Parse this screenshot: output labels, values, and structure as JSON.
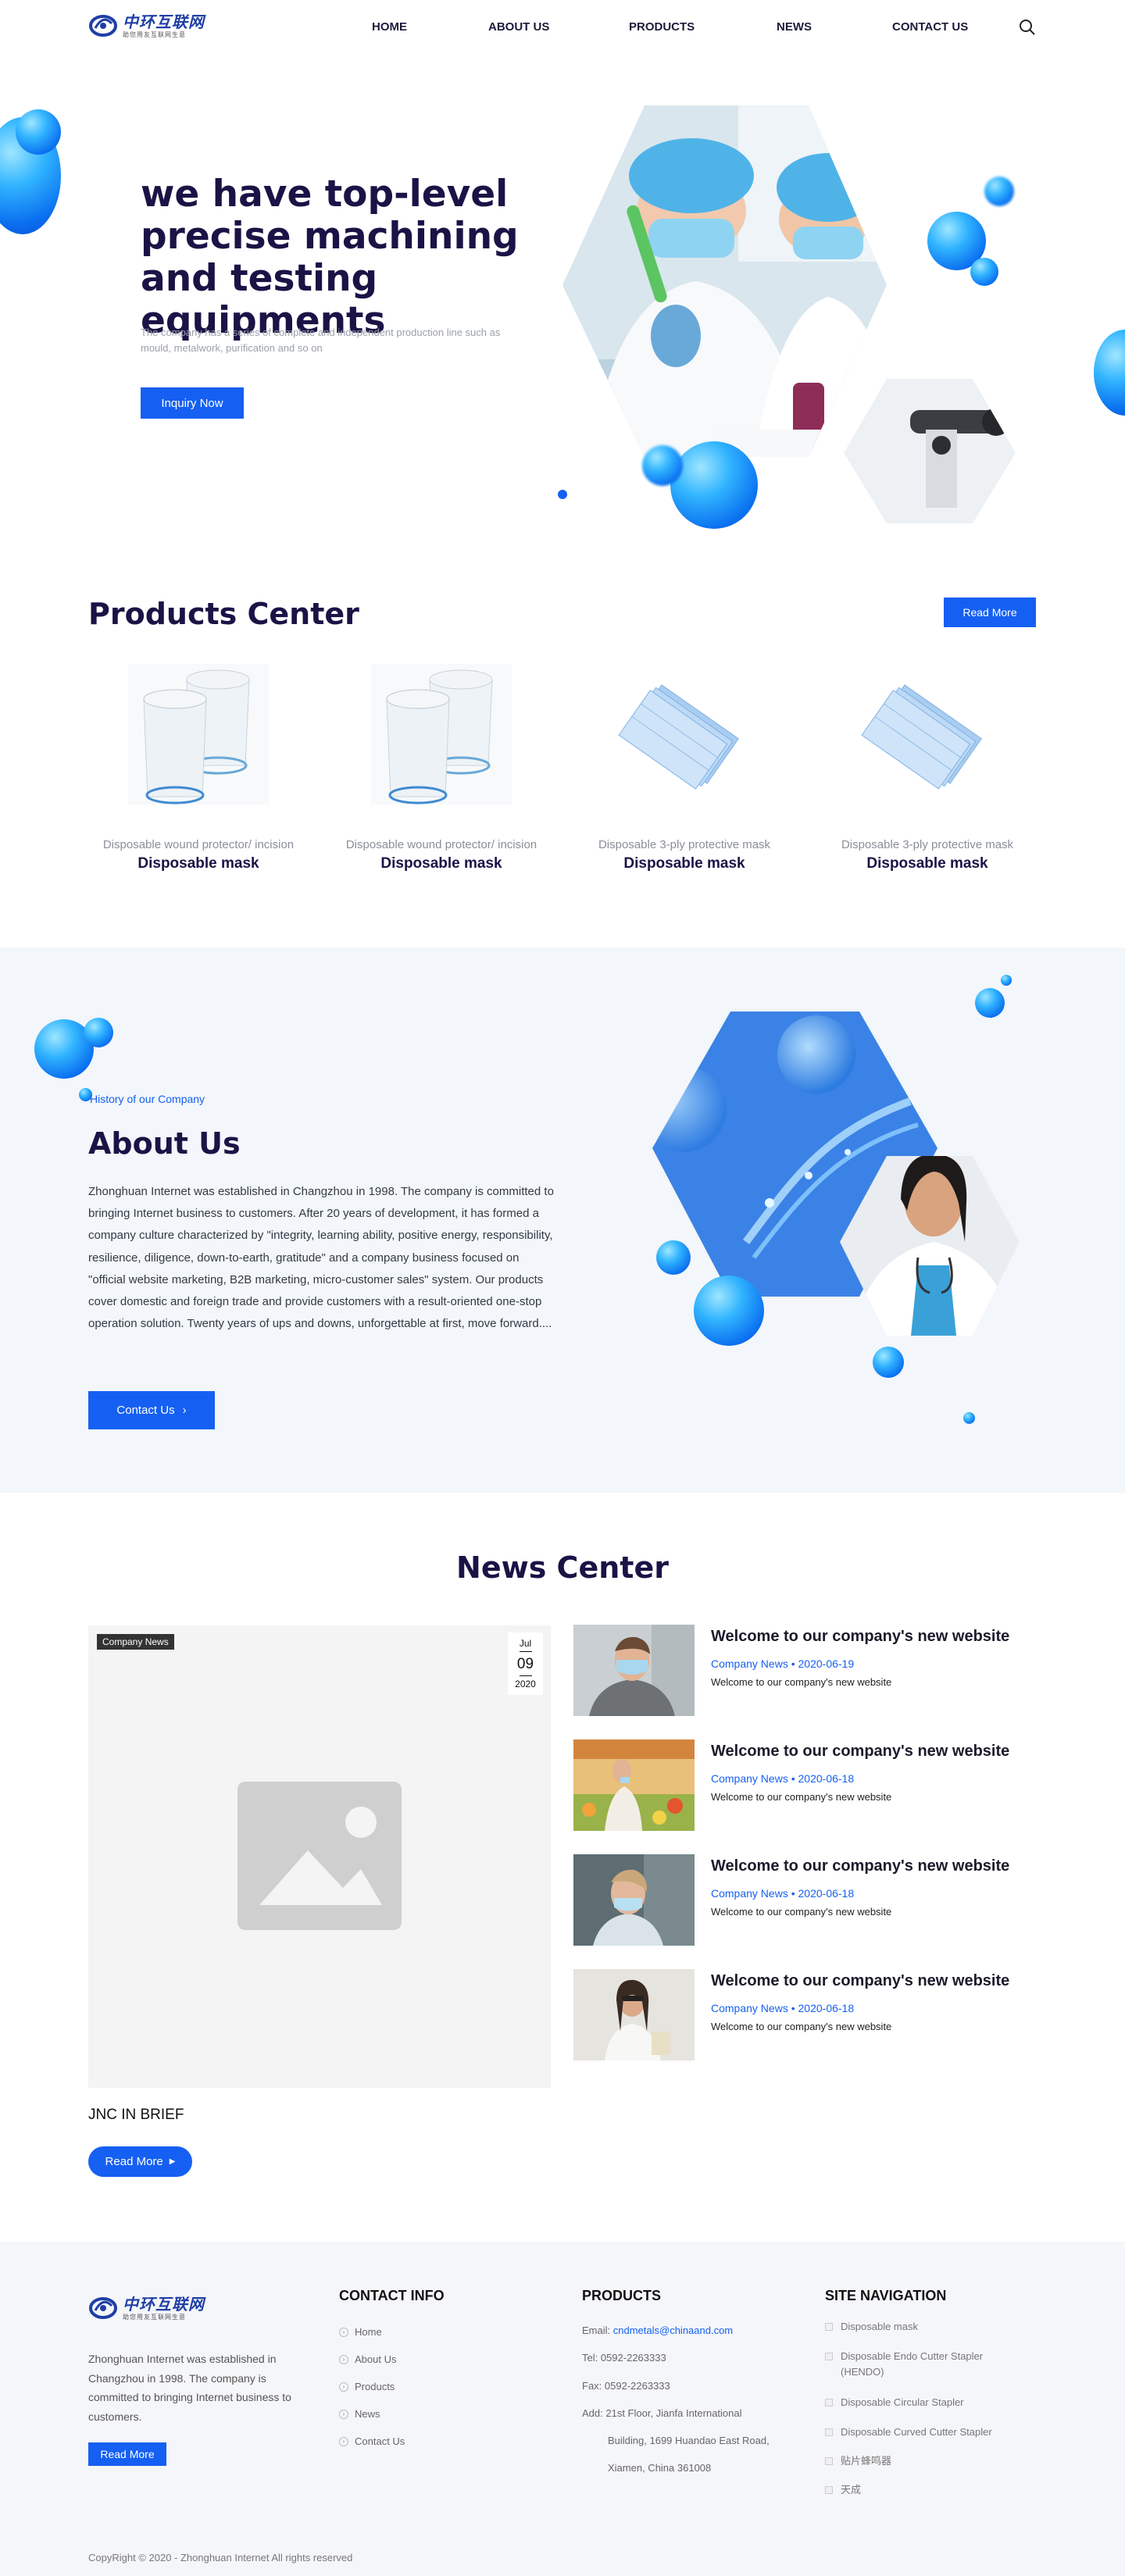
{
  "header": {
    "logo_brand": "中环互联网",
    "logo_slogan": "助您用友互联网生意",
    "nav": [
      "HOME",
      "ABOUT US",
      "PRODUCTS",
      "NEWS",
      "CONTACT US"
    ]
  },
  "hero": {
    "title": "we have top-level precise machining and testing equipments",
    "subtitle": "The company has a series of complete and independent production line such as mould, metalwork, purification and so on",
    "button": "Inquiry Now"
  },
  "products": {
    "title": "Products Center",
    "read_more": "Read More",
    "items": [
      {
        "category": "Disposable wound protector/ incision",
        "name": "Disposable mask"
      },
      {
        "category": "Disposable wound protector/ incision",
        "name": "Disposable mask"
      },
      {
        "category": "Disposable 3-ply protective mask",
        "name": "Disposable mask"
      },
      {
        "category": "Disposable 3-ply protective mask",
        "name": "Disposable mask"
      }
    ]
  },
  "about": {
    "kicker": "History of our Company",
    "title": "About Us",
    "text": "Zhonghuan Internet was established in Changzhou in 1998. The company is committed to bringing Internet business to customers. After 20 years of development, it has formed a company culture characterized by \"integrity, learning ability, positive energy, responsibility, resilience, diligence, down-to-earth, gratitude\" and a company business focused on \"official website marketing, B2B marketing, micro-customer sales\" system. Our products cover domestic and foreign trade and provide customers with a result-oriented one-stop operation solution. Twenty years of ups and downs, unforgettable at first, move forward....",
    "button": "Contact Us"
  },
  "news": {
    "title": "News Center",
    "featured": {
      "tag": "Company News",
      "month": "Jul",
      "day": "09",
      "year": "2020",
      "headline": "JNC IN BRIEF",
      "button": "Read More"
    },
    "items": [
      {
        "title": "Welcome to our company's new website",
        "category": "Company News",
        "date": "2020-06-19",
        "desc": "Welcome to our company's new website"
      },
      {
        "title": "Welcome to our company's new website",
        "category": "Company News",
        "date": "2020-06-18",
        "desc": "Welcome to our company's new website"
      },
      {
        "title": "Welcome to our company's new website",
        "category": "Company News",
        "date": "2020-06-18",
        "desc": "Welcome to our company's new website"
      },
      {
        "title": "Welcome to our company's new website",
        "category": "Company News",
        "date": "2020-06-18",
        "desc": "Welcome to our company's new website"
      }
    ]
  },
  "footer": {
    "logo_brand": "中环互联网",
    "logo_slogan": "助您用友互联网生意",
    "about": "Zhonghuan Internet was established in Changzhou in 1998. The company is committed to bringing Internet business to customers.",
    "button": "Read More",
    "contact_title": "CONTACT INFO",
    "contact_links": [
      "Home",
      "About Us",
      "Products",
      "News",
      "Contact Us"
    ],
    "products_title": "PRODUCTS",
    "email_label": "Email:",
    "email": "cndmetals@chinaand.com",
    "tel": "Tel: 0592-2263333",
    "fax": "Fax: 0592-2263333",
    "address_lines": [
      "Add: 21st Floor, Jianfa International",
      "Building, 1699 Huandao East Road,",
      "Xiamen, China 361008"
    ],
    "site_title": "SITE NAVIGATION",
    "site_links": [
      "Disposable mask",
      "Disposable Endo Cutter Stapler (HENDO)",
      "Disposable Circular Stapler",
      "Disposable Curved Cutter Stapler",
      "贴片蜂鸣器",
      "天成"
    ],
    "copyright": "CopyRight © 2020 -   Zhonghuan Internet  All rights reserved"
  },
  "colors": {
    "accent": "#1560f2",
    "title": "#1b1346",
    "about_bg": "#f3f6fa",
    "footer_bg": "#f5f6f9"
  }
}
